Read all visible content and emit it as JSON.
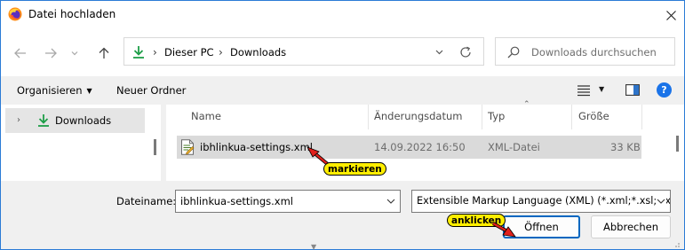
{
  "window": {
    "title": "Datei hochladen"
  },
  "address": {
    "segments": [
      "Dieser PC",
      "Downloads"
    ]
  },
  "search": {
    "placeholder": "Downloads durchsuchen"
  },
  "toolbar": {
    "organize_label": "Organisieren",
    "new_folder_label": "Neuer Ordner"
  },
  "nav_pane": {
    "items": [
      {
        "label": "Downloads",
        "selected": true
      }
    ]
  },
  "file_list": {
    "columns": [
      "Name",
      "Änderungsdatum",
      "Typ",
      "Größe"
    ],
    "rows": [
      {
        "name": "ibhlinkua-settings.xml",
        "date": "14.09.2022 16:50",
        "type": "XML-Datei",
        "size": "33 KB",
        "selected": true
      }
    ]
  },
  "bottom": {
    "filename_label": "Dateiname:",
    "filename_value": "ibhlinkua-settings.xml",
    "filetype_value": "Extensible Markup Language (XML) (*.xml;*.xsl;*.xb",
    "open_label": "Öffnen",
    "cancel_label": "Abbrechen"
  },
  "annotations": {
    "mark_label": "markieren",
    "click_label": "anklicken"
  },
  "colors": {
    "accent": "#0067c0",
    "download_green": "#1e9e48",
    "callout_yellow": "#ffee00",
    "arrow_red": "#e0201c",
    "selection_gray": "#dadada"
  },
  "icons": [
    "firefox-icon",
    "close-icon",
    "back-arrow-icon",
    "forward-arrow-icon",
    "chevron-down-icon",
    "up-arrow-icon",
    "download-folder-icon",
    "refresh-icon",
    "search-icon",
    "view-list-icon",
    "preview-pane-icon",
    "help-icon",
    "xml-file-icon"
  ]
}
